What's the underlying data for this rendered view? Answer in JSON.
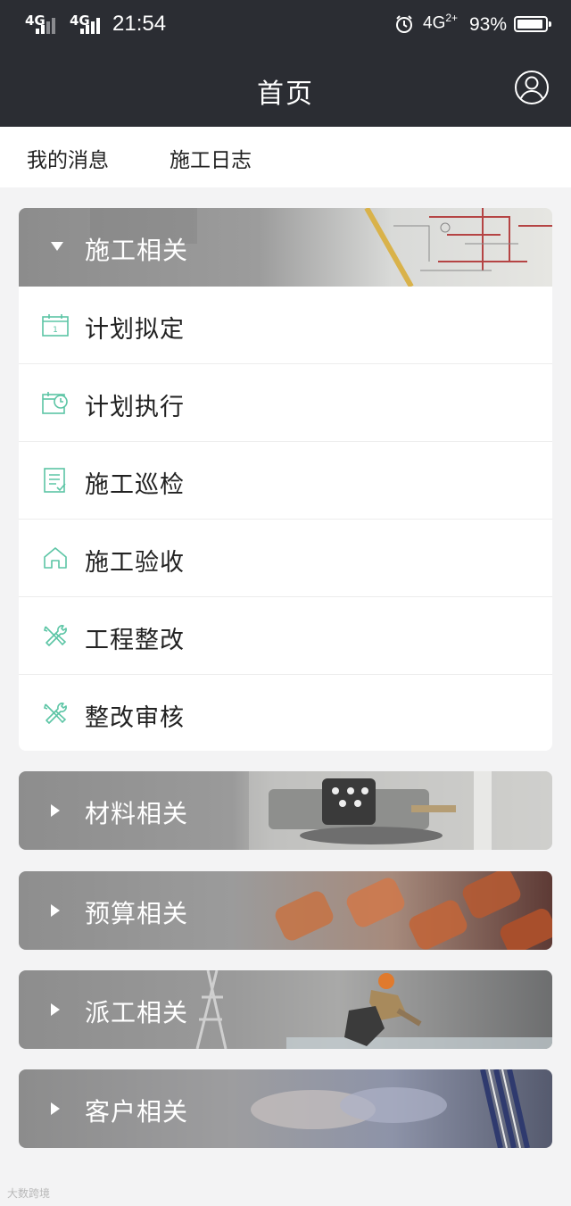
{
  "status_bar": {
    "sim1": "4G",
    "sim2": "4G",
    "time": "21:54",
    "network": "4G",
    "network_sup": "2+",
    "battery": "93%"
  },
  "header": {
    "title": "首页"
  },
  "tabs": [
    "我的消息",
    "施工日志"
  ],
  "sections": [
    {
      "label": "施工相关",
      "expanded": true,
      "items": [
        {
          "label": "计划拟定",
          "icon": "calendar-icon"
        },
        {
          "label": "计划执行",
          "icon": "calendar-clock-icon"
        },
        {
          "label": "施工巡检",
          "icon": "checklist-icon"
        },
        {
          "label": "施工验收",
          "icon": "house-icon"
        },
        {
          "label": "工程整改",
          "icon": "tools-icon"
        },
        {
          "label": "整改审核",
          "icon": "tools-icon"
        }
      ]
    },
    {
      "label": "材料相关",
      "expanded": false
    },
    {
      "label": "预算相关",
      "expanded": false
    },
    {
      "label": "派工相关",
      "expanded": false
    },
    {
      "label": "客户相关",
      "expanded": false
    }
  ],
  "colors": {
    "header_bg": "#2b2d33",
    "icon_accent": "#5cc5a5",
    "page_bg": "#f3f3f4"
  },
  "watermark": "大数跨境"
}
